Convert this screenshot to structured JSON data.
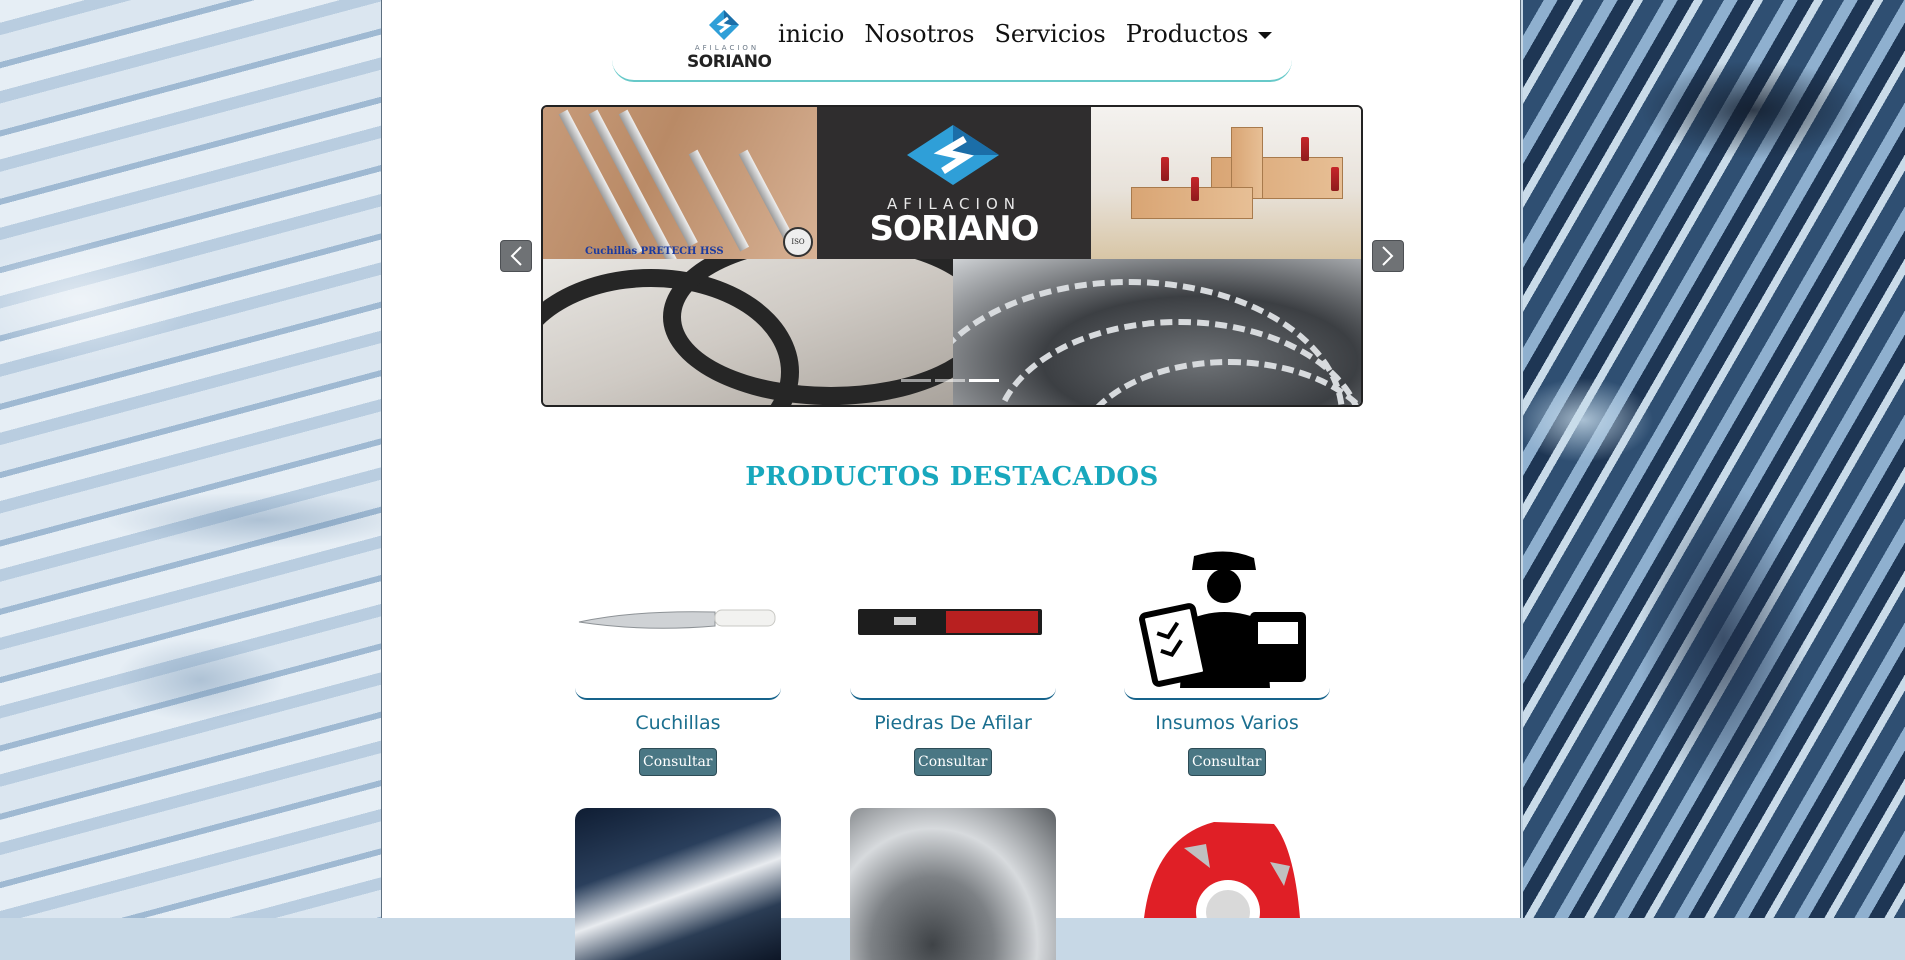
{
  "brand": {
    "logo_small": "AFILACION",
    "logo_big": "SORIANO"
  },
  "nav": {
    "items": [
      "inicio",
      "Nosotros",
      "Servicios",
      "Productos"
    ]
  },
  "carousel": {
    "caption_tile1": "Cuchillas PRETECH HSS",
    "iso_badge": "ISO 9001",
    "banner_small": "AFILACION",
    "banner_big": "SORIANO",
    "slides_count": 3,
    "active_slide": 3,
    "prev_icon": "chevron-left-icon",
    "next_icon": "chevron-right-icon"
  },
  "section": {
    "title": "PRODUCTOS DESTACADOS"
  },
  "products": [
    {
      "name": "Cuchillas",
      "button": "Consultar",
      "icon": "knife"
    },
    {
      "name": "Piedras De Afilar",
      "button": "Consultar",
      "icon": "sharpening-stone"
    },
    {
      "name": "Insumos Varios",
      "button": "Consultar",
      "icon": "worker-supplies"
    },
    {
      "icon": "band-saw-blade"
    },
    {
      "icon": "circular-saw-blade"
    },
    {
      "icon": "red-router-cutter"
    }
  ],
  "colors": {
    "accent": "#18a8bd",
    "nav_underline": "#67c9c9",
    "product_name": "#1b6f8f",
    "button_bg": "#4a7784"
  }
}
